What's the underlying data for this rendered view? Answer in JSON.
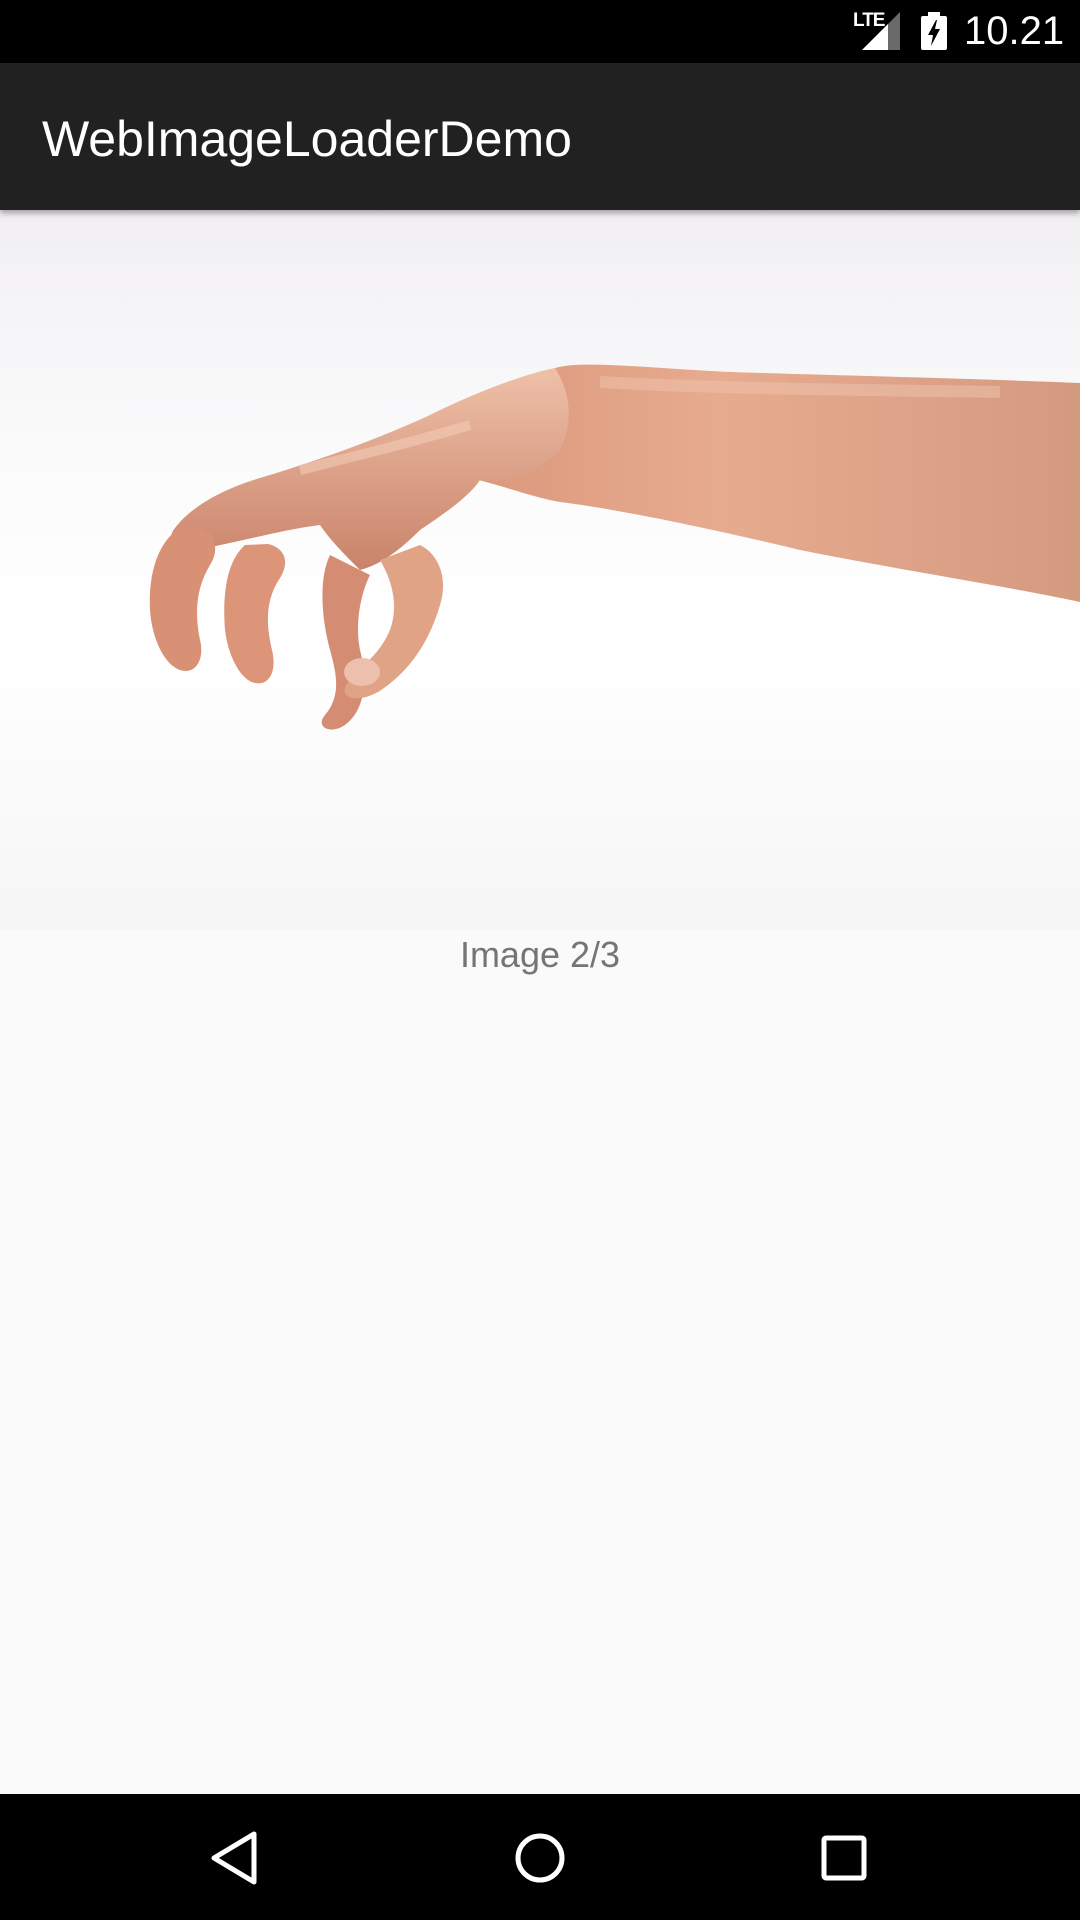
{
  "status_bar": {
    "network": "LTE",
    "time": "10.21",
    "icons": [
      "signal-icon",
      "battery-charging-icon"
    ]
  },
  "app_bar": {
    "title": "WebImageLoaderDemo",
    "background_color": "#212121"
  },
  "main": {
    "image_caption": "Image 2/3",
    "image_subject": "hand-photo"
  },
  "nav_bar": {
    "icons": [
      "back-icon",
      "home-icon",
      "recents-icon"
    ]
  }
}
